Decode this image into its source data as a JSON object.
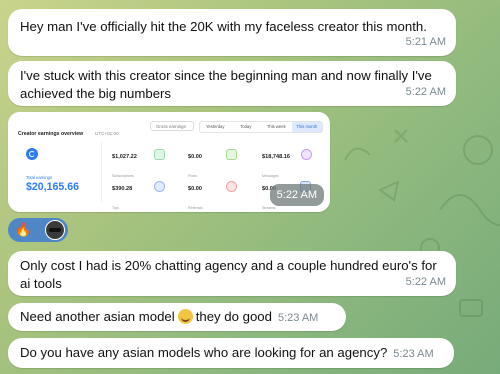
{
  "messages": [
    {
      "text": "Hey man I've officially hit the 20K with my faceless creator this month.",
      "time": "5:21 AM"
    },
    {
      "text": "I've stuck with this creator since the beginning man and now finally I've achieved the big numbers",
      "time": "5:22 AM"
    },
    {
      "text": "Only cost I had is 20% chatting agency and a couple hundred euro's for ai tools",
      "time": "5:22 AM"
    },
    {
      "text_before": "Need another asian model",
      "text_after": "they do good",
      "time": "5:23 AM"
    },
    {
      "text": "Do you have any asian models who are looking for an agency?",
      "time": "5:23 AM"
    }
  ],
  "image_message": {
    "time": "5:22 AM",
    "dashboard": {
      "title": "Creator earnings overview",
      "timezone": "UTC+01:00",
      "select": "Gross earnings",
      "tabs": [
        "Yesterday",
        "Today",
        "This week",
        "This month"
      ],
      "total_label": "Total earnings",
      "total": "$20,165.66",
      "stats": [
        {
          "value": "$1,027.22",
          "label": "Subscriptions"
        },
        {
          "value": "$0.00",
          "label": "Posts"
        },
        {
          "value": "$18,748.16",
          "label": "Messages"
        },
        {
          "value": "$390.28",
          "label": "Tips"
        },
        {
          "value": "$0.00",
          "label": "Referrals"
        },
        {
          "value": "$0.00",
          "label": "Streams"
        }
      ]
    }
  },
  "reaction": {
    "emoji": "🔥"
  }
}
